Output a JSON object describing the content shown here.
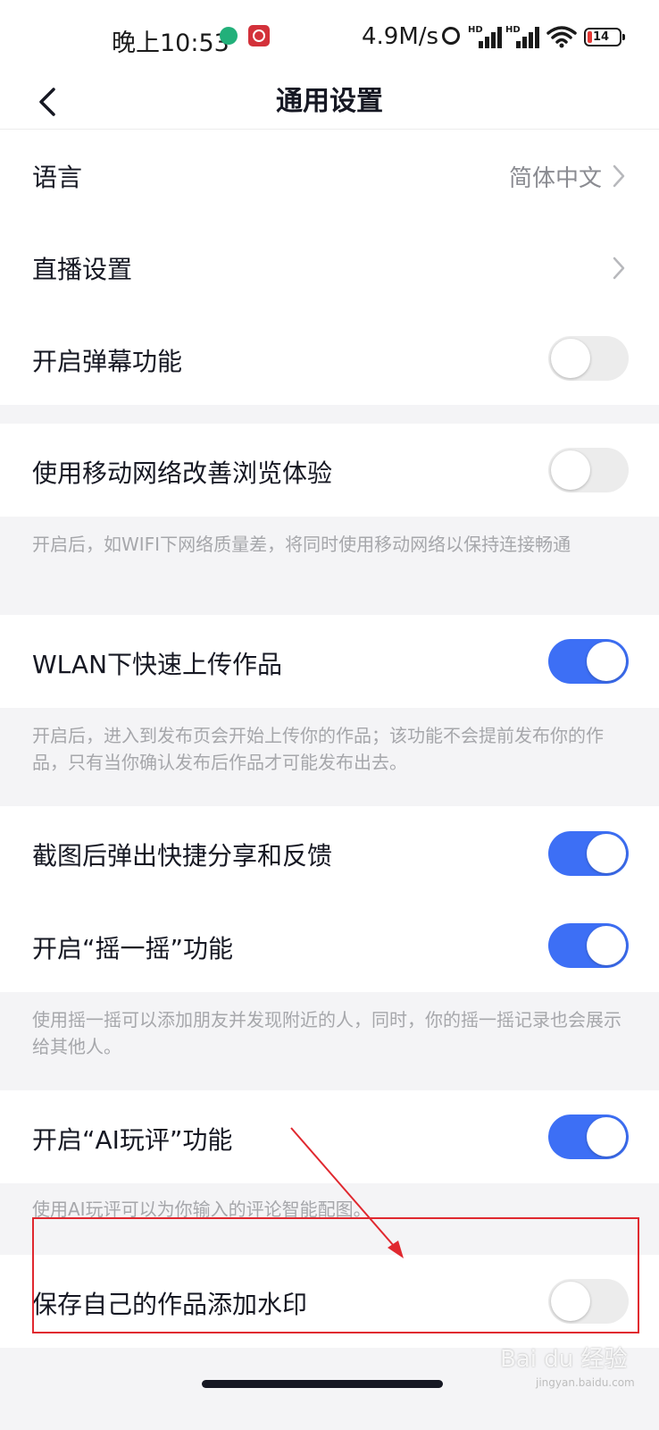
{
  "status_bar": {
    "time": "晚上10:53",
    "network_speed": "4.9M/s",
    "signal_label": "HD",
    "battery_level": "14",
    "icons": [
      "app-icon-green",
      "app-icon-red",
      "alarm-icon",
      "signal-icon",
      "wifi-icon",
      "battery-icon"
    ]
  },
  "nav": {
    "title": "通用设置",
    "back_icon": "chevron-left-icon"
  },
  "settings": {
    "language": {
      "label": "语言",
      "value": "简体中文"
    },
    "live_settings": {
      "label": "直播设置"
    },
    "danmaku": {
      "label": "开启弹幕功能",
      "on": false
    },
    "mobile_network": {
      "label": "使用移动网络改善浏览体验",
      "on": false,
      "desc": "开启后，如WIFI下网络质量差，将同时使用移动网络以保持连接畅通"
    },
    "wlan_upload": {
      "label": "WLAN下快速上传作品",
      "on": true,
      "desc": "开启后，进入到发布页会开始上传你的作品；该功能不会提前发布你的作品，只有当你确认发布后作品才可能发布出去。"
    },
    "screenshot_share": {
      "label": "截图后弹出快捷分享和反馈",
      "on": true
    },
    "shake": {
      "label": "开启“摇一摇”功能",
      "on": true,
      "desc": "使用摇一摇可以添加朋友并发现附近的人，同时，你的摇一摇记录也会展示给其他人。"
    },
    "ai_comment": {
      "label": "开启“AI玩评”功能",
      "on": true,
      "desc": "使用AI玩评可以为你输入的评论智能配图。"
    },
    "watermark": {
      "label": "保存自己的作品添加水印",
      "on": false
    }
  },
  "colors": {
    "accent": "#3d6ff5",
    "annotation": "#e0282f"
  },
  "watermark_text": "Bai du 经验",
  "watermark_sub": "jingyan.baidu.com"
}
